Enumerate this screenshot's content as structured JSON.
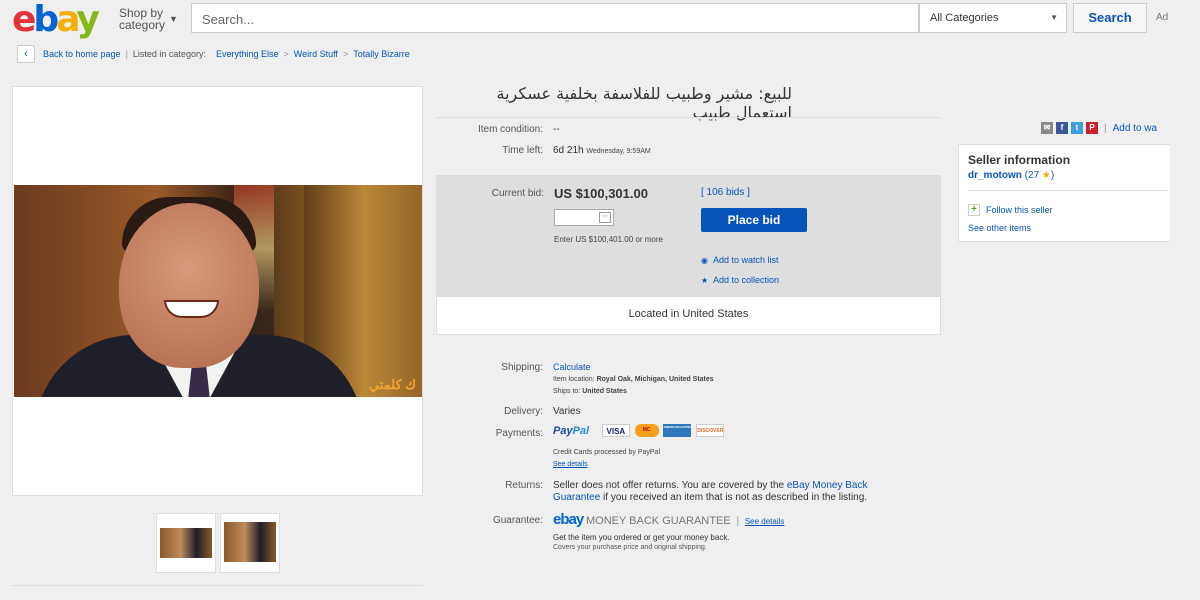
{
  "header": {
    "logo": {
      "e": "e",
      "b": "b",
      "a": "a",
      "y": "y"
    },
    "shop_by_line1": "Shop by",
    "shop_by_line2": "category",
    "search_placeholder": "Search...",
    "category_select": "All Categories",
    "search_button": "Search",
    "advanced": "Ad"
  },
  "breadcrumb": {
    "back": "Back to home page",
    "listed_in": "Listed in category:",
    "items": [
      "Everything Else",
      "Weird Stuff",
      "Totally Bizarre"
    ]
  },
  "image": {
    "watermark": "ك كلمتي",
    "thumbnail_count": 2
  },
  "item": {
    "title": "للبيع: مشير وطبيب للفلاسفة بخلفية عسكرية استعمال طبيب",
    "condition_label": "Item condition:",
    "condition_value": "--",
    "time_left_label": "Time left:",
    "time_left_value": "6d 21h",
    "time_left_end": "Wednesday, 9:59AM"
  },
  "bid": {
    "current_label": "Current bid:",
    "amount": "US $100,301.00",
    "bids_count": "[ 106 bids ]",
    "place_bid": "Place bid",
    "hint": "Enter US $100,401.00 or more",
    "watch": "Add to watch list",
    "collection": "Add to collection",
    "location": "Located in United States"
  },
  "details": {
    "shipping_label": "Shipping:",
    "shipping_value": "Calculate",
    "item_location_label": "Item location:",
    "item_location_value": "Royal Oak, Michigan, United States",
    "ships_to_label": "Ships to:",
    "ships_to_value": "United States",
    "delivery_label": "Delivery:",
    "delivery_value": "Varies",
    "payments_label": "Payments:",
    "paypal_a": "Pay",
    "paypal_b": "Pal",
    "cards": [
      "VISA",
      "MC",
      "AMERICAN EXPRESS",
      "DISCOVER"
    ],
    "cards_note": "Credit Cards processed by PayPal",
    "see_details": "See details",
    "returns_label": "Returns:",
    "returns_text1": "Seller does not offer returns. You are covered by the ",
    "returns_link1": "eBay Money Back",
    "returns_link2": "Guarantee",
    "returns_text2": " if you received an item that is not as described in the listing.",
    "guarantee_label": "Guarantee:",
    "guarantee_brand": "ebay",
    "guarantee_title": "MONEY BACK GUARANTEE",
    "guarantee_link": "See details",
    "guarantee_line1": "Get the item you ordered or get your money back.",
    "guarantee_line2": "Covers your purchase price and original shipping."
  },
  "seller": {
    "title": "Seller information",
    "name": "dr_motown",
    "feedback": "(27",
    "feedback_close": ")",
    "follow": "Follow this seller",
    "other": "See other items"
  },
  "share": {
    "add_to": "Add to wa"
  },
  "colors": {
    "link": "#0654ba",
    "place_bid": "#0654ba",
    "ebay_red": "#e53238",
    "ebay_blue": "#0064d2",
    "ebay_yellow": "#f5af02",
    "ebay_green": "#86b817"
  }
}
